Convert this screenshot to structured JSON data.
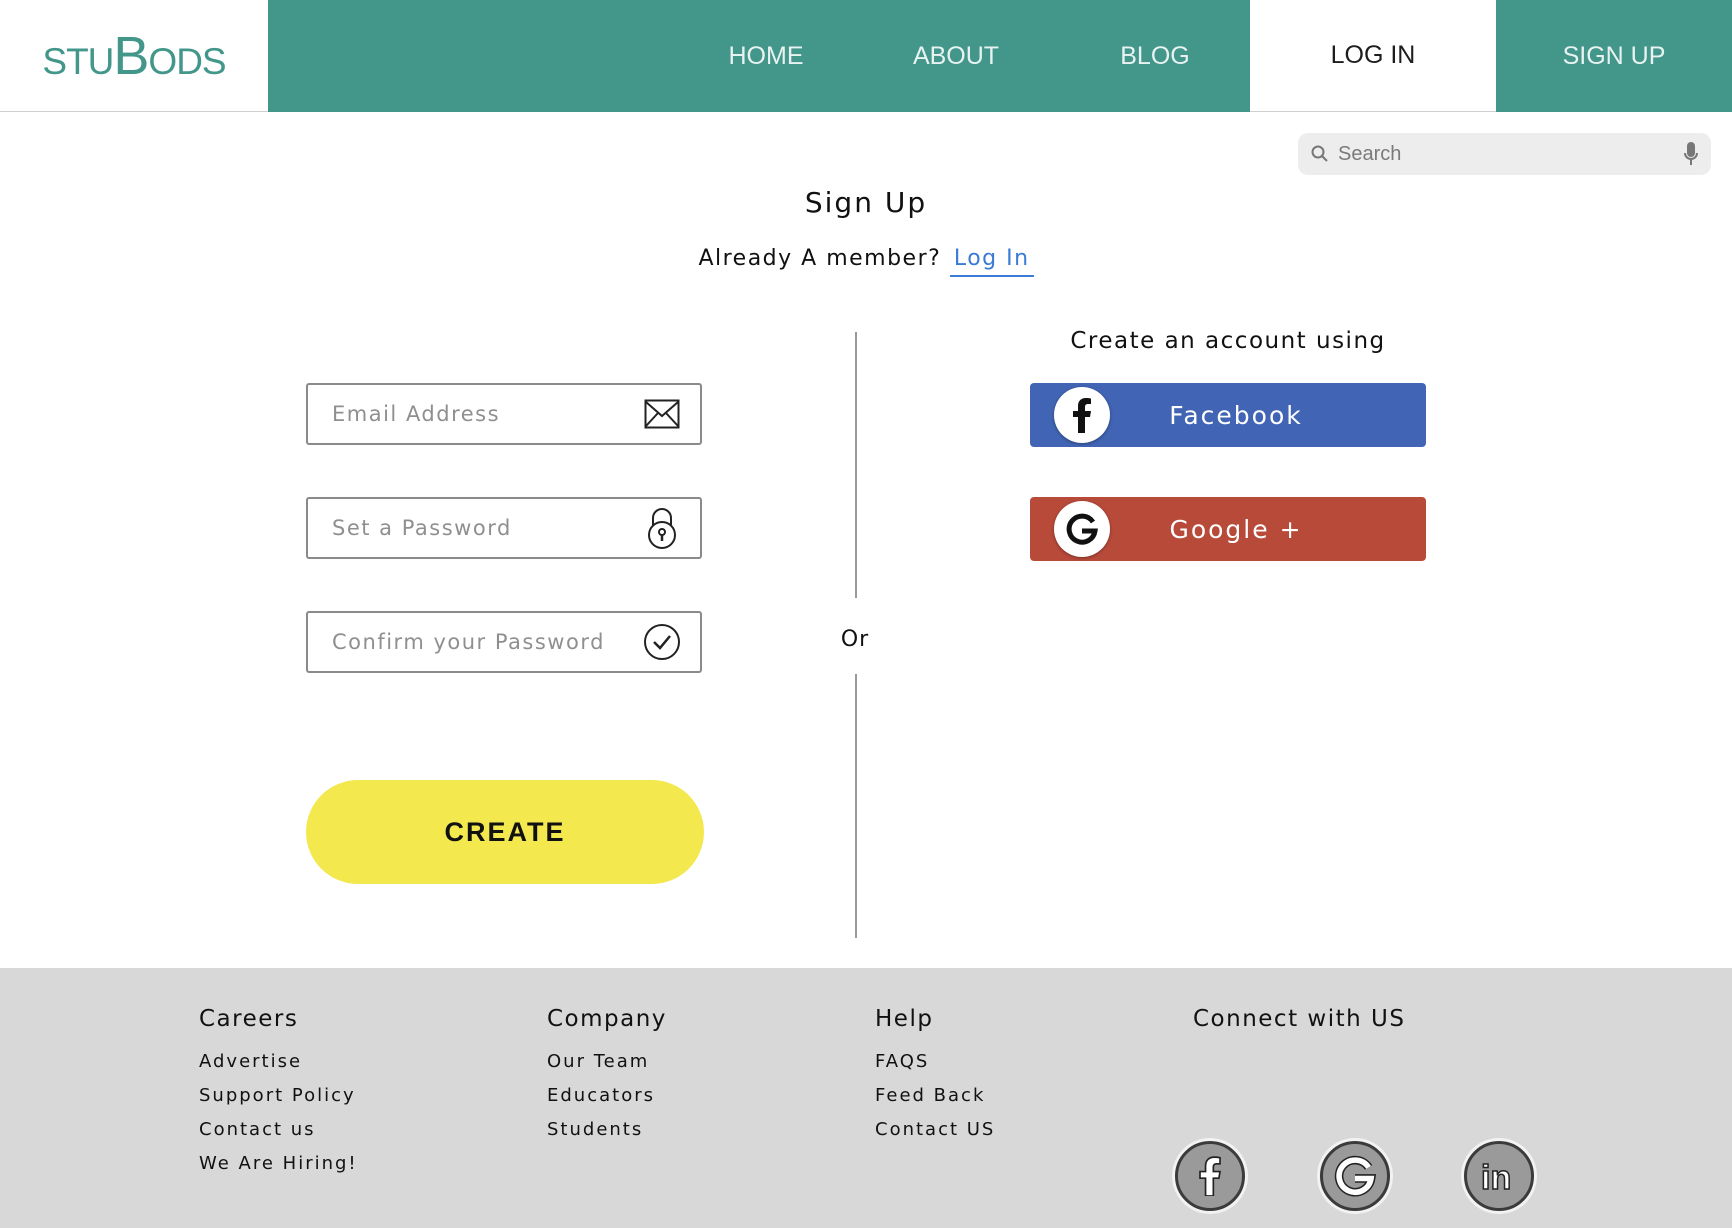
{
  "header": {
    "logo_small": "STU",
    "logo_big_b": "B",
    "logo_rest": "ODS",
    "nav": [
      {
        "label": "HOME"
      },
      {
        "label": "ABOUT"
      },
      {
        "label": "BLOG"
      },
      {
        "label": "LOG IN",
        "active": true
      },
      {
        "label": "SIGN UP"
      }
    ],
    "colors": {
      "brand": "#43968a"
    }
  },
  "search": {
    "placeholder": "Search"
  },
  "main": {
    "title": "Sign Up",
    "member_text": "Already A member?",
    "login_link": "Log In",
    "fields": {
      "email_placeholder": "Email Address",
      "password_placeholder": "Set a Password",
      "confirm_placeholder": "Confirm your Password"
    },
    "create_label": "CREATE",
    "or_label": "Or",
    "social_heading": "Create an account using",
    "facebook_label": "Facebook",
    "google_label": "Google +",
    "colors": {
      "create": "#f4e84f",
      "facebook": "#4164b4",
      "google": "#b84a3a",
      "link": "#3a7bd5"
    }
  },
  "footer": {
    "careers": {
      "title": "Careers",
      "links": [
        "Advertise",
        "Support Policy",
        "Contact us",
        "We Are Hiring!"
      ]
    },
    "company": {
      "title": "Company",
      "links": [
        "Our Team",
        "Educators",
        "Students"
      ]
    },
    "help": {
      "title": "Help",
      "links": [
        "FAQS",
        "Feed Back",
        "Contact US"
      ]
    },
    "connect": {
      "title": "Connect with US",
      "icons": [
        "facebook-icon",
        "google-icon",
        "linkedin-icon"
      ]
    }
  }
}
